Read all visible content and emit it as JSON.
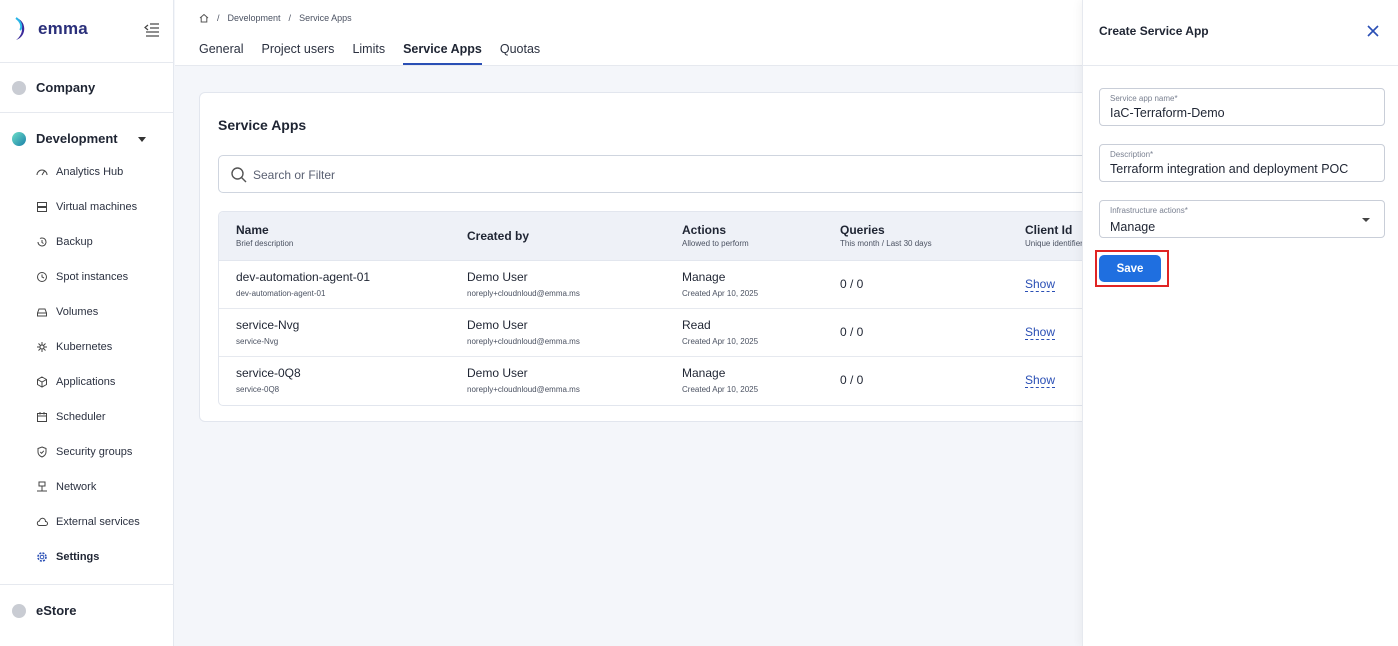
{
  "brand": {
    "name": "emma"
  },
  "sidebar": {
    "orgs": [
      {
        "label": "Company"
      },
      {
        "label": "Development"
      },
      {
        "label": "eStore"
      }
    ],
    "items": [
      {
        "label": "Analytics Hub",
        "icon": "analytics-icon"
      },
      {
        "label": "Virtual machines",
        "icon": "server-icon"
      },
      {
        "label": "Backup",
        "icon": "backup-icon"
      },
      {
        "label": "Spot instances",
        "icon": "clock-icon"
      },
      {
        "label": "Volumes",
        "icon": "volume-icon"
      },
      {
        "label": "Kubernetes",
        "icon": "kubernetes-icon"
      },
      {
        "label": "Applications",
        "icon": "box-icon"
      },
      {
        "label": "Scheduler",
        "icon": "calendar-icon"
      },
      {
        "label": "Security groups",
        "icon": "shield-icon"
      },
      {
        "label": "Network",
        "icon": "network-icon"
      },
      {
        "label": "External services",
        "icon": "cloud-icon"
      },
      {
        "label": "Settings",
        "icon": "gear-icon",
        "active": true
      }
    ]
  },
  "breadcrumb": {
    "items": [
      "Development",
      "Service Apps"
    ]
  },
  "tabs": [
    "General",
    "Project users",
    "Limits",
    "Service Apps",
    "Quotas"
  ],
  "main": {
    "title": "Service Apps",
    "search_placeholder": "Search or Filter",
    "columns": [
      {
        "label": "Name",
        "sub": "Brief description"
      },
      {
        "label": "Created by",
        "sub": ""
      },
      {
        "label": "Actions",
        "sub": "Allowed to perform"
      },
      {
        "label": "Queries",
        "sub": "This month / Last 30 days"
      },
      {
        "label": "Client Id",
        "sub": "Unique identifier"
      }
    ],
    "rows": [
      {
        "name": "dev-automation-agent-01",
        "desc": "dev-automation-agent-01",
        "user": "Demo User",
        "email": "noreply+cloudnloud@emma.ms",
        "action": "Manage",
        "created": "Created Apr 10, 2025",
        "queries": "0 / 0",
        "client": "Show"
      },
      {
        "name": "service-Nvg",
        "desc": "service-Nvg",
        "user": "Demo User",
        "email": "noreply+cloudnloud@emma.ms",
        "action": "Read",
        "created": "Created Apr 10, 2025",
        "queries": "0 / 0",
        "client": "Show"
      },
      {
        "name": "service-0Q8",
        "desc": "service-0Q8",
        "user": "Demo User",
        "email": "noreply+cloudnloud@emma.ms",
        "action": "Manage",
        "created": "Created Apr 10, 2025",
        "queries": "0 / 0",
        "client": "Show"
      }
    ]
  },
  "drawer": {
    "title": "Create Service App",
    "fields": {
      "name": {
        "label": "Service app name*",
        "value": "IaC-Terraform-Demo"
      },
      "description": {
        "label": "Description*",
        "value": "Terraform integration and deployment POC"
      },
      "actions": {
        "label": "Infrastructure actions*",
        "value": "Manage"
      }
    },
    "save_label": "Save"
  },
  "colors": {
    "accent": "#1f6fe0",
    "link": "#2a4fb5",
    "highlight": "#e02424"
  }
}
